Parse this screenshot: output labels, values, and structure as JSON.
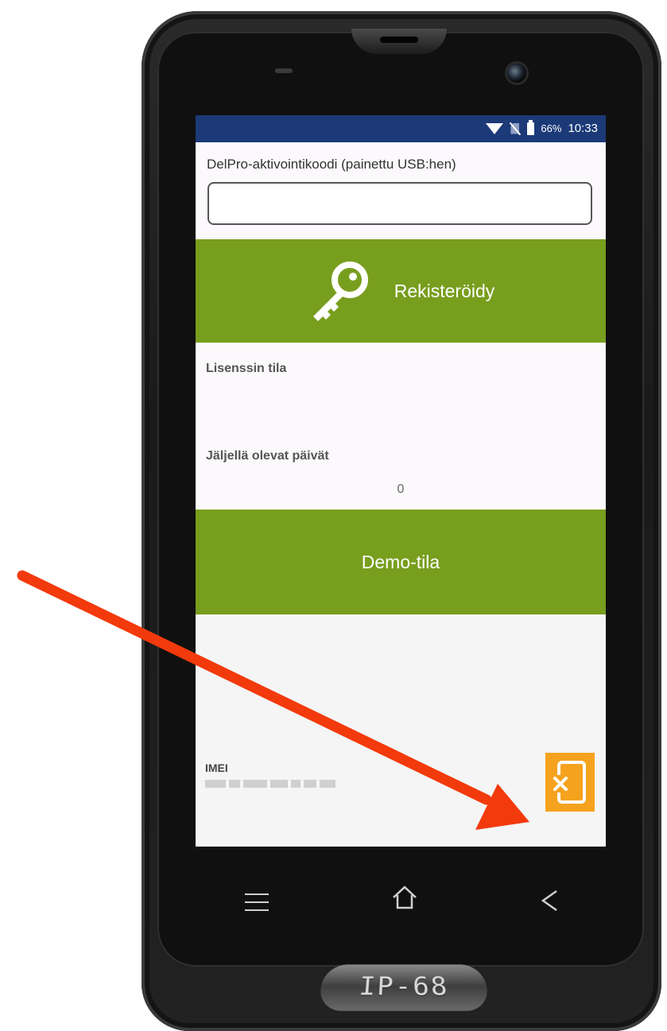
{
  "status_bar": {
    "battery_percent": "66%",
    "time": "10:33"
  },
  "activation": {
    "label": "DelPro-aktivointikoodi (painettu USB:hen)",
    "input_value": "",
    "register_label": "Rekisteröidy"
  },
  "license": {
    "status_label": "Lisenssin tila",
    "days_label": "Jäljellä olevat päivät",
    "days_value": "0"
  },
  "demo": {
    "label": "Demo-tila"
  },
  "device": {
    "imei_label": "IMEI"
  },
  "phone": {
    "badge": "IP-68"
  },
  "colors": {
    "status_bar": "#1c3a78",
    "button_green": "#789e1e",
    "exit_orange": "#f5a21e",
    "arrow_red": "#f23a0c"
  }
}
